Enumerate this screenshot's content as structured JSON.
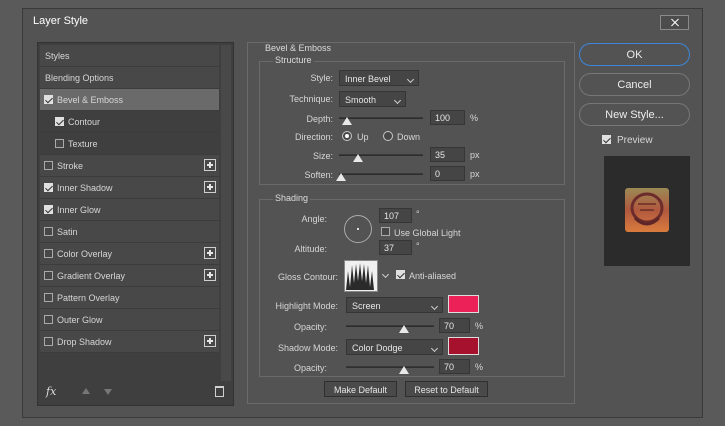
{
  "window": {
    "title": "Layer Style"
  },
  "styles_list": {
    "header": "Styles",
    "blending_options": "Blending Options",
    "items": [
      {
        "label": "Bevel & Emboss",
        "checked": true,
        "selected": true
      },
      {
        "label": "Contour",
        "checked": true
      },
      {
        "label": "Texture",
        "checked": false
      },
      {
        "label": "Stroke",
        "checked": false
      },
      {
        "label": "Inner Shadow",
        "checked": true
      },
      {
        "label": "Inner Glow",
        "checked": true
      },
      {
        "label": "Satin",
        "checked": false
      },
      {
        "label": "Color Overlay",
        "checked": false
      },
      {
        "label": "Gradient Overlay",
        "checked": false
      },
      {
        "label": "Pattern Overlay",
        "checked": false
      },
      {
        "label": "Outer Glow",
        "checked": false
      },
      {
        "label": "Drop Shadow",
        "checked": false
      }
    ],
    "fx_label": "fx"
  },
  "bevel": {
    "section_title": "Bevel & Emboss",
    "structure": {
      "title": "Structure",
      "style_label": "Style:",
      "style_value": "Inner Bevel",
      "technique_label": "Technique:",
      "technique_value": "Smooth",
      "depth_label": "Depth:",
      "depth_value": "100",
      "depth_unit": "%",
      "direction_label": "Direction:",
      "direction_up": "Up",
      "direction_down": "Down",
      "size_label": "Size:",
      "size_value": "35",
      "size_unit": "px",
      "soften_label": "Soften:",
      "soften_value": "0",
      "soften_unit": "px"
    },
    "shading": {
      "title": "Shading",
      "angle_label": "Angle:",
      "angle_value": "107",
      "angle_unit": "°",
      "global_light_label": "Use Global Light",
      "altitude_label": "Altitude:",
      "altitude_value": "37",
      "altitude_unit": "°",
      "gloss_contour_label": "Gloss Contour:",
      "anti_aliased_label": "Anti-aliased",
      "highlight_mode_label": "Highlight Mode:",
      "highlight_mode_value": "Screen",
      "highlight_color": "#ec2157",
      "highlight_opacity_label": "Opacity:",
      "highlight_opacity_value": "70",
      "highlight_opacity_unit": "%",
      "shadow_mode_label": "Shadow Mode:",
      "shadow_mode_value": "Color Dodge",
      "shadow_color": "#a6112d",
      "shadow_opacity_label": "Opacity:",
      "shadow_opacity_value": "70",
      "shadow_opacity_unit": "%"
    },
    "make_default": "Make Default",
    "reset_default": "Reset to Default"
  },
  "buttons": {
    "ok": "OK",
    "cancel": "Cancel",
    "new_style": "New Style...",
    "preview": "Preview"
  }
}
